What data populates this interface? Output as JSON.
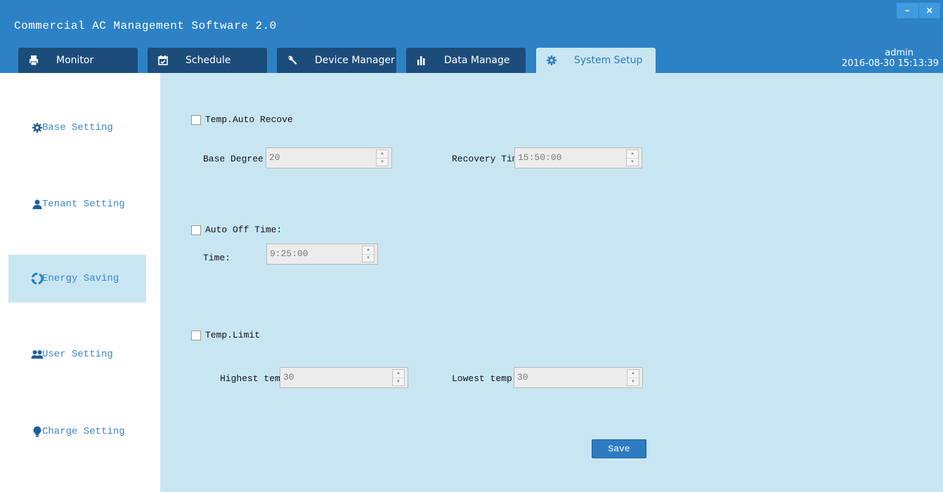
{
  "app": {
    "title": "Commercial AC Management Software 2.0",
    "minimize_label": "–",
    "close_label": "×"
  },
  "tabs": [
    {
      "label": "Monitor",
      "icon": "printer-icon",
      "active": false
    },
    {
      "label": "Schedule",
      "icon": "calendar-check-icon",
      "active": false
    },
    {
      "label": "Device Manager",
      "icon": "wrench-icon",
      "active": false
    },
    {
      "label": "Data Manage",
      "icon": "bar-chart-icon",
      "active": false
    },
    {
      "label": "System Setup",
      "icon": "gear-icon",
      "active": true
    }
  ],
  "user": {
    "name": "admin",
    "datetime": "2016-08-30 15:13:39"
  },
  "sidebar": {
    "items": [
      {
        "label": "Base Setting",
        "icon": "gear-icon",
        "active": false
      },
      {
        "label": "Tenant Setting",
        "icon": "person-icon",
        "active": false
      },
      {
        "label": "Energy Saving",
        "icon": "recycle-icon",
        "active": true
      },
      {
        "label": "User Setting",
        "icon": "users-icon",
        "active": false
      },
      {
        "label": "Charge Setting",
        "icon": "bulb-icon",
        "active": false
      }
    ]
  },
  "energy": {
    "temp_auto_recover": {
      "checkbox_label": "Temp.Auto Recove",
      "checked": false,
      "base_degree_label": "Base Degree",
      "base_degree_value": "20",
      "recovery_time_label": "Recovery Time",
      "recovery_time_value": "15:50:00"
    },
    "auto_off": {
      "checkbox_label": "Auto Off Time:",
      "checked": false,
      "time_label": "Time:",
      "time_value": "9:25:00"
    },
    "temp_limit": {
      "checkbox_label": "Temp.Limit",
      "checked": false,
      "highest_label": "Highest temp",
      "highest_value": "30",
      "lowest_label": "Lowest temp",
      "lowest_value": "30"
    },
    "save_label": "Save"
  },
  "colors": {
    "header_bg": "#2d82c6",
    "tab_bg": "#1c4d7a",
    "active_bg": "#c8e6f2",
    "accent_text": "#3a86c8",
    "save_button": "#2d7cc2"
  }
}
